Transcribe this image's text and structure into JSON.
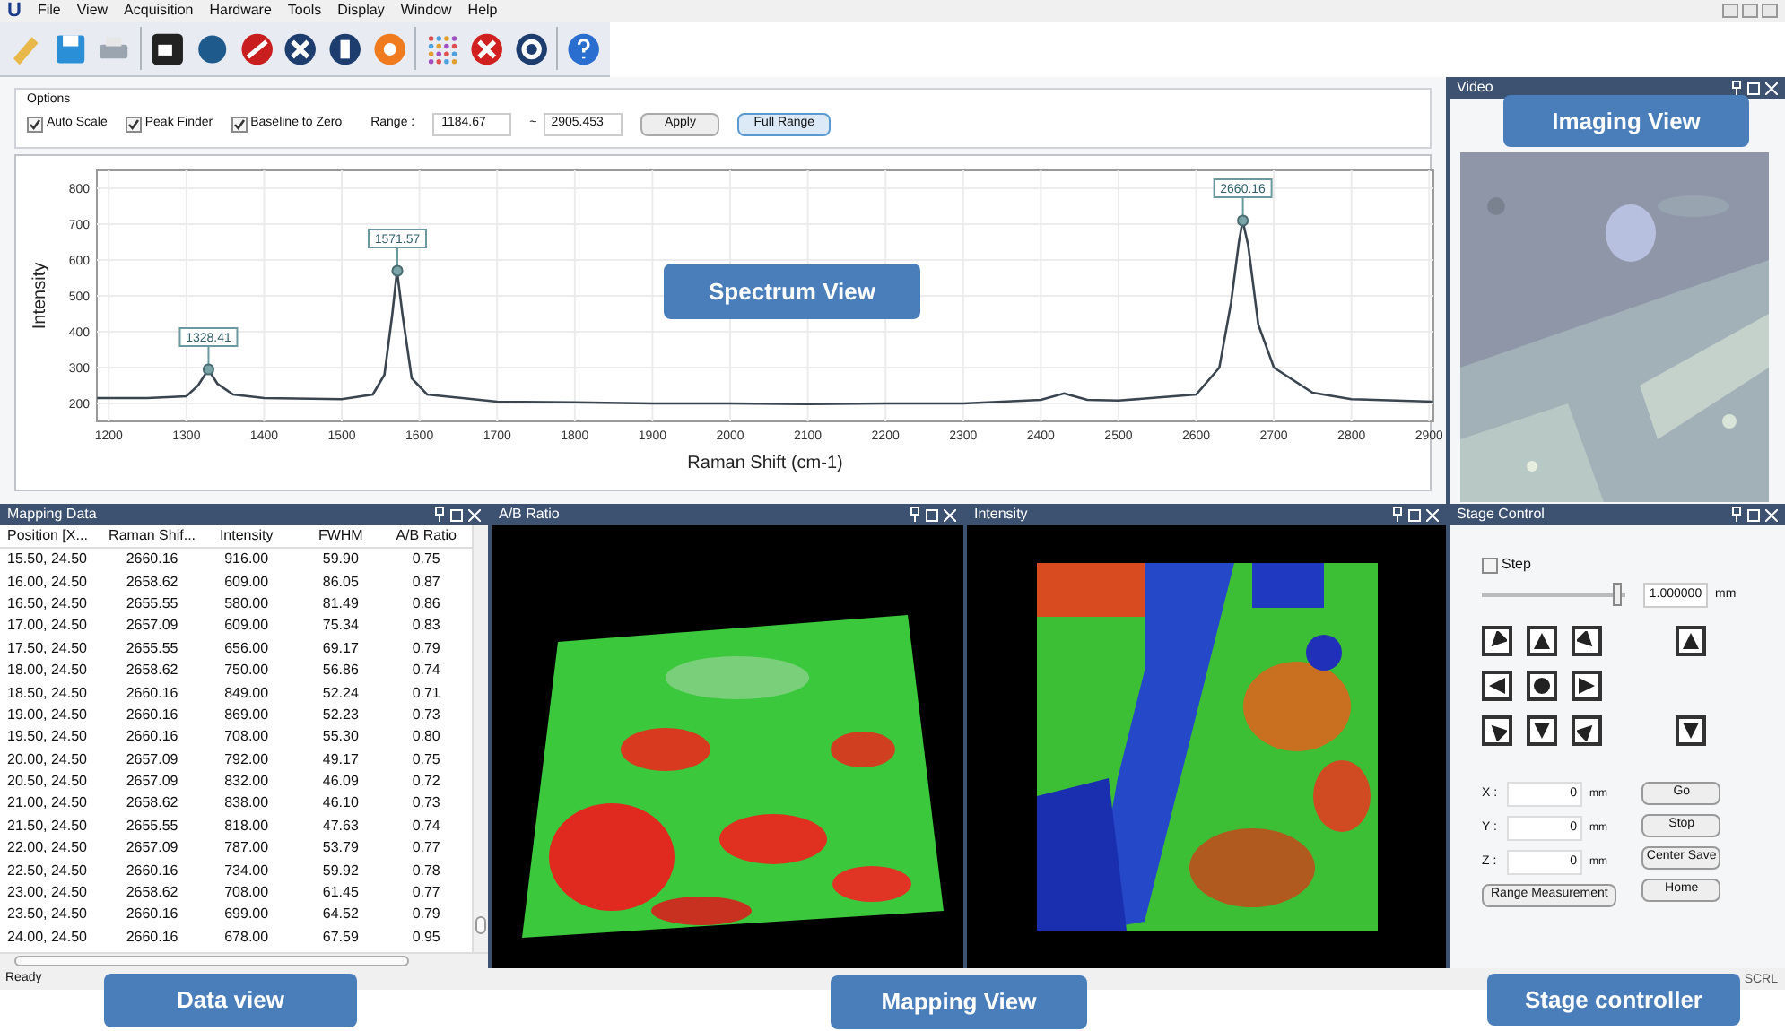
{
  "app": {
    "logo": "U",
    "menu": [
      "File",
      "View",
      "Acquisition",
      "Hardware",
      "Tools",
      "Display",
      "Window",
      "Help"
    ]
  },
  "options": {
    "title": "Options",
    "checkboxes": [
      {
        "label": "Auto Scale",
        "checked": true
      },
      {
        "label": "Peak Finder",
        "checked": true
      },
      {
        "label": "Baseline to Zero",
        "checked": true
      }
    ],
    "range_label": "Range :",
    "range_from": "1184.67",
    "range_separator": "~",
    "range_to": "2905.453",
    "buttons": [
      "Apply",
      "Full Range"
    ]
  },
  "spectrum": {
    "chart_data": {
      "type": "line",
      "xlabel": "Raman Shift (cm-1)",
      "ylabel": "Intensity",
      "x": [
        1185,
        1250,
        1300,
        1315,
        1328,
        1340,
        1360,
        1400,
        1500,
        1540,
        1555,
        1565,
        1571,
        1578,
        1590,
        1610,
        1700,
        1800,
        1900,
        2000,
        2100,
        2200,
        2300,
        2400,
        2430,
        2440,
        2460,
        2500,
        2600,
        2630,
        2645,
        2655,
        2660,
        2667,
        2680,
        2700,
        2750,
        2800,
        2905
      ],
      "values": [
        215,
        215,
        220,
        250,
        295,
        255,
        225,
        215,
        212,
        225,
        280,
        450,
        570,
        450,
        270,
        225,
        205,
        203,
        200,
        200,
        198,
        200,
        200,
        210,
        228,
        222,
        210,
        208,
        225,
        300,
        480,
        650,
        710,
        640,
        420,
        300,
        230,
        212,
        205
      ],
      "xlim": [
        1184.67,
        2905.453
      ],
      "ylim": [
        150,
        850
      ],
      "xticks": [
        1200,
        1300,
        1400,
        1500,
        1600,
        1700,
        1800,
        1900,
        2000,
        2100,
        2200,
        2300,
        2400,
        2500,
        2600,
        2700,
        2800,
        2900
      ],
      "yticks": [
        200,
        300,
        400,
        500,
        600,
        700,
        800
      ],
      "grid": true,
      "annotations": [
        {
          "x": 1328.41,
          "y": 295,
          "text": "1328.41"
        },
        {
          "x": 1571.57,
          "y": 570,
          "text": "1571.57"
        },
        {
          "x": 2660.16,
          "y": 710,
          "text": "2660.16"
        }
      ]
    }
  },
  "video": {
    "title": "Video"
  },
  "mapping_data": {
    "title": "Mapping Data",
    "columns": [
      "Position [X...",
      "Raman Shif...",
      "Intensity",
      "FWHM",
      "A/B Ratio"
    ],
    "rows": [
      [
        "15.50, 24.50",
        "2660.16",
        "916.00",
        "59.90",
        "0.75"
      ],
      [
        "16.00, 24.50",
        "2658.62",
        "609.00",
        "86.05",
        "0.87"
      ],
      [
        "16.50, 24.50",
        "2655.55",
        "580.00",
        "81.49",
        "0.86"
      ],
      [
        "17.00, 24.50",
        "2657.09",
        "609.00",
        "75.34",
        "0.83"
      ],
      [
        "17.50, 24.50",
        "2655.55",
        "656.00",
        "69.17",
        "0.79"
      ],
      [
        "18.00, 24.50",
        "2658.62",
        "750.00",
        "56.86",
        "0.74"
      ],
      [
        "18.50, 24.50",
        "2660.16",
        "849.00",
        "52.24",
        "0.71"
      ],
      [
        "19.00, 24.50",
        "2660.16",
        "869.00",
        "52.23",
        "0.73"
      ],
      [
        "19.50, 24.50",
        "2660.16",
        "708.00",
        "55.30",
        "0.80"
      ],
      [
        "20.00, 24.50",
        "2657.09",
        "792.00",
        "49.17",
        "0.75"
      ],
      [
        "20.50, 24.50",
        "2657.09",
        "832.00",
        "46.09",
        "0.72"
      ],
      [
        "21.00, 24.50",
        "2658.62",
        "838.00",
        "46.10",
        "0.73"
      ],
      [
        "21.50, 24.50",
        "2655.55",
        "818.00",
        "47.63",
        "0.74"
      ],
      [
        "22.00, 24.50",
        "2657.09",
        "787.00",
        "53.79",
        "0.77"
      ],
      [
        "22.50, 24.50",
        "2660.16",
        "734.00",
        "59.92",
        "0.78"
      ],
      [
        "23.00, 24.50",
        "2658.62",
        "708.00",
        "61.45",
        "0.77"
      ],
      [
        "23.50, 24.50",
        "2660.16",
        "699.00",
        "64.52",
        "0.79"
      ],
      [
        "24.00, 24.50",
        "2660.16",
        "678.00",
        "67.59",
        "0.95"
      ]
    ]
  },
  "ab_ratio": {
    "title": "A/B Ratio"
  },
  "intensity": {
    "title": "Intensity"
  },
  "stage_control": {
    "title": "Stage Control",
    "step": {
      "label": "Step",
      "checked": false
    },
    "step_slider": {
      "level": 0.95
    },
    "step_value": "1.000000",
    "step_unit": "mm",
    "axes": [
      {
        "label": "X :",
        "value": "0",
        "unit": "mm"
      },
      {
        "label": "Y :",
        "value": "0",
        "unit": "mm"
      },
      {
        "label": "Z :",
        "value": "0",
        "unit": "mm"
      }
    ],
    "range_button": "Range Measurement",
    "buttons": [
      "Go",
      "Stop",
      "Center Save",
      "Home"
    ]
  },
  "status_bar": {
    "text": "Ready",
    "indicator": "SCRL"
  },
  "callouts": [
    "Imaging View",
    "Spectrum View",
    "Data view",
    "Mapping View",
    "Stage controller"
  ]
}
